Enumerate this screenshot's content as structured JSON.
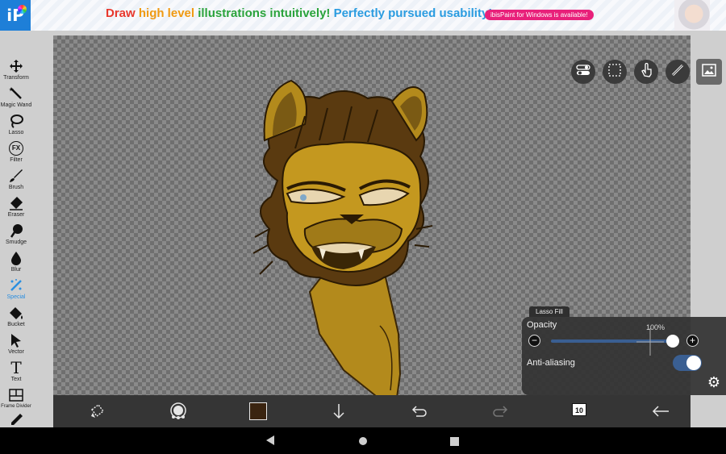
{
  "banner": {
    "app_logo": "ibisPaint-logo",
    "headline": {
      "part1": "Draw ",
      "part2": "high level ",
      "part3": "illustrations intuitively! ",
      "part4": "Perfectly pursued usability!"
    },
    "pill": "ibisPaint for Windows is available!"
  },
  "toolbar": {
    "items": [
      {
        "label": "Transform",
        "icon": "move-arrows-icon"
      },
      {
        "label": "Magic Wand",
        "icon": "magic-wand-icon"
      },
      {
        "label": "Lasso",
        "icon": "lasso-icon"
      },
      {
        "label": "Filter",
        "icon": "fx-icon",
        "glyph": "FX"
      },
      {
        "label": "Brush",
        "icon": "brush-icon"
      },
      {
        "label": "Eraser",
        "icon": "eraser-icon"
      },
      {
        "label": "Smudge",
        "icon": "smudge-icon"
      },
      {
        "label": "Blur",
        "icon": "drop-icon"
      },
      {
        "label": "Special",
        "icon": "special-wand-icon",
        "active": true
      },
      {
        "label": "Bucket",
        "icon": "bucket-icon"
      },
      {
        "label": "Vector",
        "icon": "vector-cursor-icon"
      },
      {
        "label": "Text",
        "icon": "text-icon",
        "glyph": "T"
      },
      {
        "label": "Frame Divider",
        "icon": "frame-divider-icon"
      }
    ]
  },
  "lasso_panel": {
    "tab_title": "Lasso Fill",
    "opacity_label": "Opacity",
    "opacity_value": "100%",
    "opacity_fraction": 1.0,
    "minus_glyph": "−",
    "plus_glyph": "+",
    "antialias_label": "Anti-aliasing",
    "antialias_on": true,
    "settings_icon": "gear-icon"
  },
  "actionbar": {
    "layer_count": "10",
    "color_hex": "#3a2410",
    "icons": [
      "transform-selection-icon",
      "brush-size-icon",
      "color-swatch",
      "download-arrow-icon",
      "undo-icon",
      "redo-icon",
      "layers-icon",
      "back-arrow-icon"
    ]
  },
  "colors": {
    "accent": "#2b8fe0",
    "panel": "#323232",
    "toggle": "#3a5f92"
  }
}
